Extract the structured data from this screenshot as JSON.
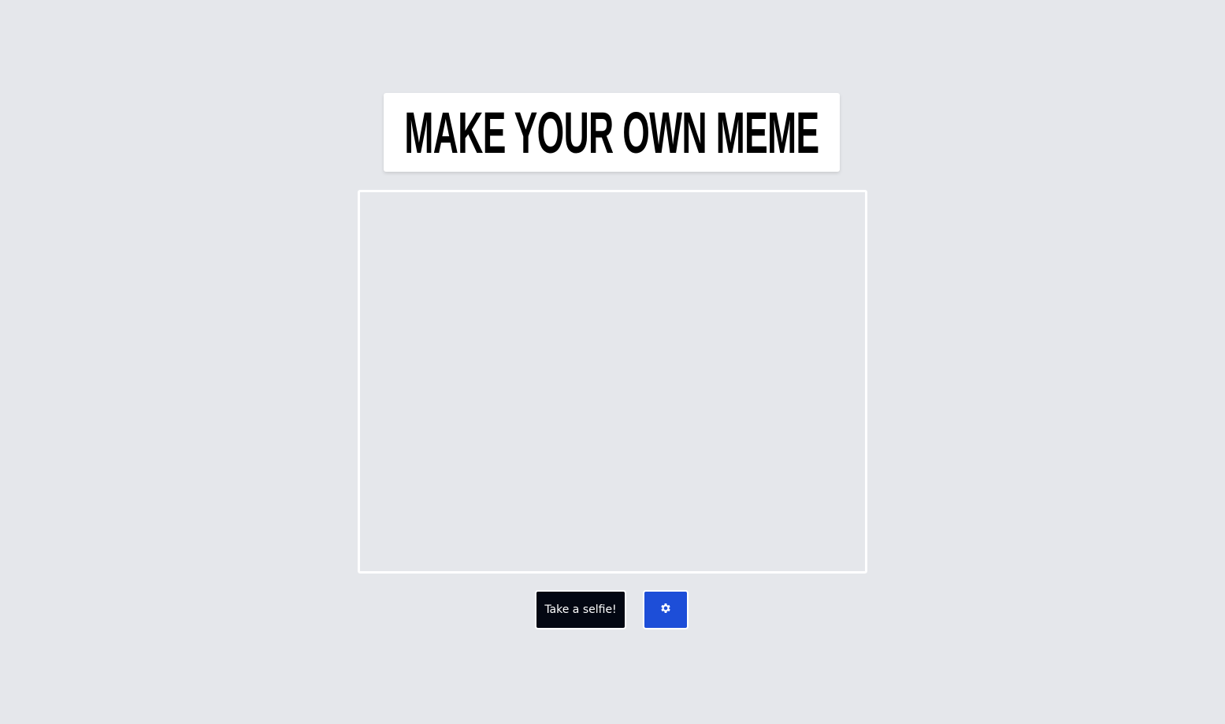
{
  "header": {
    "title": "MAKE YOUR OWN MEME"
  },
  "camera": {
    "state": "empty"
  },
  "actions": {
    "selfie_label": "Take a selfie!",
    "settings_icon": "gear-icon"
  },
  "colors": {
    "background": "#e5e7eb",
    "selfie_button": "#030712",
    "settings_button": "#1d4ed8"
  }
}
